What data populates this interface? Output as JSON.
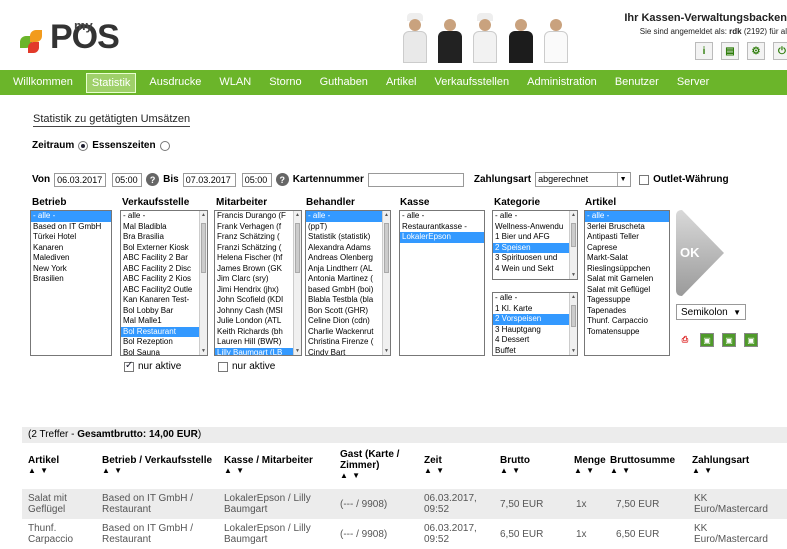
{
  "header": {
    "logo_my": "my",
    "logo_pos": "POS",
    "app_title": "Ihr Kassen-Verwaltungsbacken",
    "login_prefix": "Sie sind angemeldet als:",
    "login_user": "rdk",
    "login_suffix": "(2192) für al",
    "icons": [
      "info-icon",
      "document-icon",
      "settings-icon",
      "logout-icon"
    ],
    "icon_glyphs": [
      "i",
      "▤",
      "⚙",
      "⏻"
    ]
  },
  "nav": {
    "items": [
      "Willkommen",
      "Statistik",
      "Ausdrucke",
      "WLAN",
      "Storno",
      "Guthaben",
      "Artikel",
      "Verkaufsstellen",
      "Administration",
      "Benutzer",
      "Server"
    ],
    "active": "Statistik"
  },
  "page_title": "Statistik zu getätigten Umsätzen",
  "zeitraum": {
    "label": "Zeitraum",
    "option": "Essenszeiten"
  },
  "filter": {
    "von_label": "Von",
    "von_date": "06.03.2017",
    "von_time": "05:00",
    "bis_label": "Bis",
    "bis_date": "07.03.2017",
    "bis_time": "05:00",
    "kartennummer_label": "Kartennummer",
    "kartennummer_value": "",
    "zahlungsart_label": "Zahlungsart",
    "zahlungsart_value": "abgerechnet",
    "outlet_label": "Outlet-Währung"
  },
  "lists": {
    "betrieb": {
      "label": "Betrieb",
      "items": [
        "- alle -",
        "Based on IT GmbH",
        "Türkei Hotel",
        "Kanaren",
        "Malediven",
        "New York",
        "Brasilien"
      ],
      "selected": [
        0
      ]
    },
    "verkaufsstelle": {
      "label": "Verkaufsstelle",
      "items": [
        "- alle -",
        "Mal Bladibla",
        "Bra Brasilia",
        "Bol Externer Kiosk",
        "ABC Facility 2 Bar",
        "ABC Facility 2 Disc",
        "ABC Facility 2 Kios",
        "ABC Facility2 Outle",
        "Kan Kanaren Test-",
        "Bol Lobby Bar",
        "Mal Malle1",
        "Bol Restaurant",
        "Bol Rezeption",
        "Bol Sauna"
      ],
      "selected": [
        11
      ],
      "nur_aktive": "nur aktive"
    },
    "mitarbeiter": {
      "label": "Mitarbeiter",
      "items": [
        "Francis Durango (F",
        "Frank Verhagen (f",
        "Franz Schätzing (",
        "Franzi Schätzing (",
        "Helena Fischer (hf",
        "James Brown (GK",
        "Jim Clarc (sry)",
        "Jimi Hendrix (jhx)",
        "John Scofield (KDI",
        "Johnny Cash (MSI",
        "Julie London (ATL",
        "Keith Richards (bh",
        "Lauren Hill (BWR)",
        "Lilly Baumgart (LB"
      ],
      "selected": [
        13
      ],
      "nur_aktive": "nur aktive"
    },
    "behandler": {
      "label": "Behandler",
      "items": [
        "- alle -",
        "(ppT)",
        "Statistik (statistik)",
        "Alexandra Adams",
        "Andreas Olenberg",
        "Anja Lindtherr (AL",
        "Antonia Martinez (",
        "based GmbH (boi)",
        "Blabla Testbla (bla",
        "Bon Scott (GHR)",
        "Celine Dion (cdn)",
        "Charlie Wackenrut",
        "Christina Firenze (",
        "Cindy Bart"
      ],
      "selected": [
        0
      ]
    },
    "kasse": {
      "label": "Kasse",
      "items": [
        "- alle -",
        "Restaurantkasse -",
        "LokalerEpson"
      ],
      "selected": [
        2
      ]
    },
    "kategorie1": {
      "label": "Kategorie",
      "items": [
        "- alle -",
        "Wellness-Anwendu",
        "1 Bier und AFG",
        "2 Speisen",
        "3 Spirituosen und",
        "4 Wein und Sekt"
      ],
      "selected": [
        3
      ]
    },
    "kategorie2": {
      "items": [
        "- alle -",
        "1 Kl. Karte",
        "2 Vorspeisen",
        "3 Hauptgang",
        "4 Dessert",
        "Buffet"
      ],
      "selected": [
        2
      ]
    },
    "artikel": {
      "label": "Artikel",
      "items": [
        "- alle -",
        "3erlei Bruscheta",
        "Antipasti Teller",
        "Caprese",
        "Markt-Salat",
        "Rieslingsüppchen",
        "Salat mit Garnelen",
        "Salat mit Geflügel",
        "Tagessuppe",
        "Tapenades",
        "Thunf. Carpaccio",
        "Tomatensuppe"
      ],
      "selected": [
        0
      ]
    }
  },
  "ok_label": "OK",
  "export_format": "Semikolon",
  "results": {
    "count_text": "(2 Treffer - ",
    "total_label": "Gesamtbrutto: 14,00 EUR",
    "count_close": ")",
    "columns": [
      "Artikel",
      "Betrieb / Verkaufsstelle",
      "Kasse / Mitarbeiter",
      "Gast (Karte / Zimmer)",
      "Zeit",
      "Brutto",
      "Menge",
      "Bruttosumme",
      "Zahlungsart"
    ],
    "sort_glyph": "▲ ▼",
    "rows": [
      {
        "artikel": "Salat mit Geflügel",
        "betrieb": "Based on IT GmbH / Restaurant",
        "kasse": "LokalerEpson / Lilly Baumgart",
        "gast": "(--- / 9908)",
        "zeit": "06.03.2017, 09:52",
        "brutto": "7,50 EUR",
        "menge": "1x",
        "summe": "7,50 EUR",
        "zahlungsart": "KK Euro/Mastercard"
      },
      {
        "artikel": "Thunf. Carpaccio",
        "betrieb": "Based on IT GmbH / Restaurant",
        "kasse": "LokalerEpson / Lilly Baumgart",
        "gast": "(--- / 9908)",
        "zeit": "06.03.2017, 09:52",
        "brutto": "6,50 EUR",
        "menge": "1x",
        "summe": "6,50 EUR",
        "zahlungsart": "KK Euro/Mastercard"
      }
    ]
  },
  "colors": {
    "nav_green": "#6bb52a",
    "selection": "#3399ff"
  }
}
